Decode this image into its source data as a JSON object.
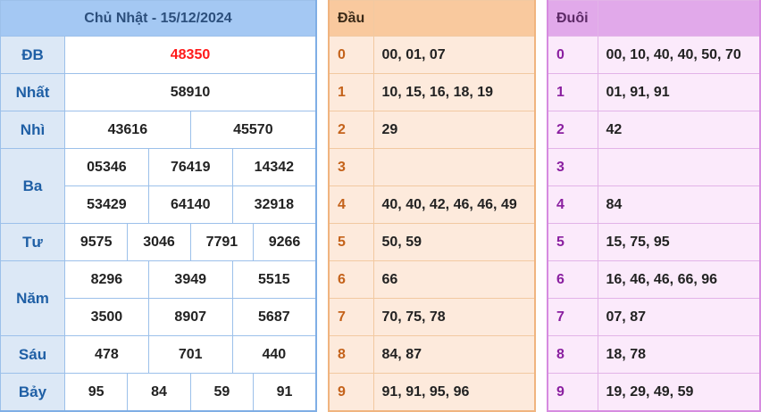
{
  "results": {
    "title": "Chủ Nhật - 15/12/2024",
    "db": {
      "label": "ĐB",
      "values": [
        "48350"
      ]
    },
    "nhat": {
      "label": "Nhất",
      "values": [
        "58910"
      ]
    },
    "nhi": {
      "label": "Nhì",
      "values": [
        "43616",
        "45570"
      ]
    },
    "ba": {
      "label": "Ba",
      "values": [
        "05346",
        "76419",
        "14342",
        "53429",
        "64140",
        "32918"
      ]
    },
    "tu": {
      "label": "Tư",
      "values": [
        "9575",
        "3046",
        "7791",
        "9266"
      ]
    },
    "nam": {
      "label": "Năm",
      "values": [
        "8296",
        "3949",
        "5515",
        "3500",
        "8907",
        "5687"
      ]
    },
    "sau": {
      "label": "Sáu",
      "values": [
        "478",
        "701",
        "440"
      ]
    },
    "bay": {
      "label": "Bảy",
      "values": [
        "95",
        "84",
        "59",
        "91"
      ]
    }
  },
  "dau": {
    "header": "Đầu",
    "rows": [
      {
        "digit": "0",
        "values": "00, 01, 07"
      },
      {
        "digit": "1",
        "values": "10, 15, 16, 18, 19"
      },
      {
        "digit": "2",
        "values": "29"
      },
      {
        "digit": "3",
        "values": ""
      },
      {
        "digit": "4",
        "values": "40, 40, 42, 46, 46, 49"
      },
      {
        "digit": "5",
        "values": "50, 59"
      },
      {
        "digit": "6",
        "values": "66"
      },
      {
        "digit": "7",
        "values": "70, 75, 78"
      },
      {
        "digit": "8",
        "values": "84, 87"
      },
      {
        "digit": "9",
        "values": "91, 91, 95, 96"
      }
    ]
  },
  "duoi": {
    "header": "Đuôi",
    "rows": [
      {
        "digit": "0",
        "values": "00, 10, 40, 40, 50, 70"
      },
      {
        "digit": "1",
        "values": "01, 91, 91"
      },
      {
        "digit": "2",
        "values": "42"
      },
      {
        "digit": "3",
        "values": ""
      },
      {
        "digit": "4",
        "values": "84"
      },
      {
        "digit": "5",
        "values": "15, 75, 95"
      },
      {
        "digit": "6",
        "values": "16, 46, 46, 66, 96"
      },
      {
        "digit": "7",
        "values": "07, 87"
      },
      {
        "digit": "8",
        "values": "18, 78"
      },
      {
        "digit": "9",
        "values": "19, 29, 49, 59"
      }
    ]
  }
}
